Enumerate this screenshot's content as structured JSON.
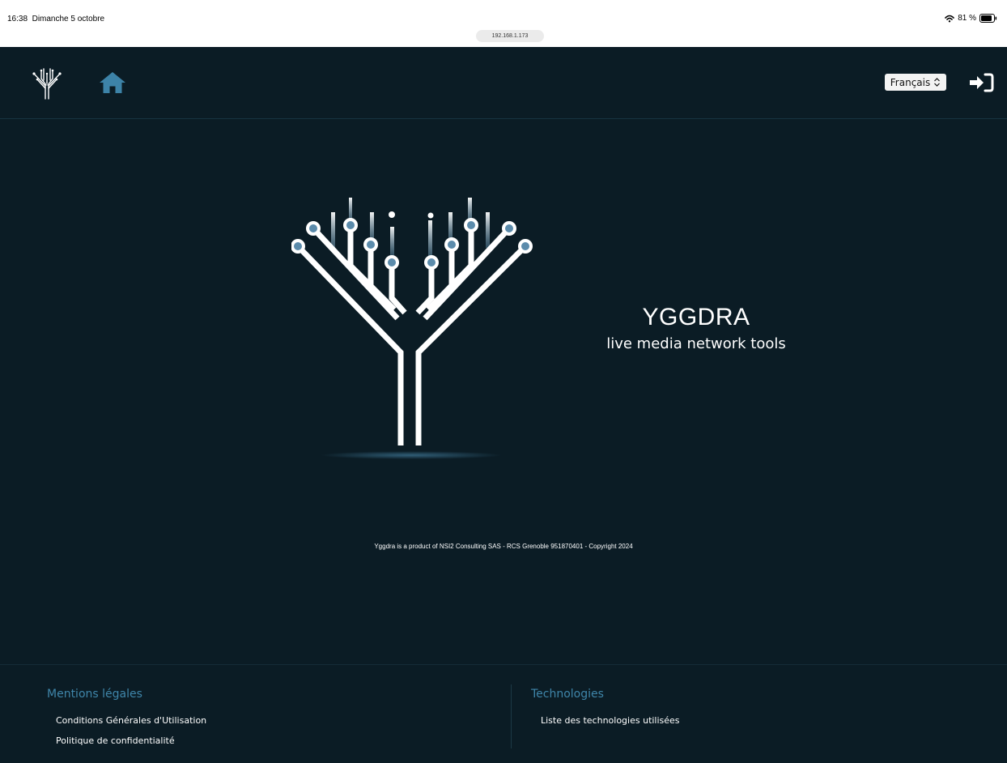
{
  "status_bar": {
    "time": "16:38",
    "date": "Dimanche 5 octobre",
    "url": "192.168.1.173",
    "battery": "81 %",
    "icons": [
      "wifi-icon",
      "battery-icon"
    ]
  },
  "header": {
    "logo_icon": "yggdra-tree-logo-icon",
    "home_icon": "home-icon",
    "language": {
      "selected": "Français"
    },
    "login_icon": "login-arrow-icon"
  },
  "hero": {
    "title": "YGGDRA",
    "subtitle": "live media network tools"
  },
  "copyright": "Yggdra is a product of NSI2 Consulting SAS - RCS Grenoble 951870401 - Copyright 2024",
  "footer": {
    "legal": {
      "heading": "Mentions légales",
      "links": [
        "Conditions Générales d'Utilisation",
        "Politique de confidentialité"
      ]
    },
    "tech": {
      "heading": "Technologies",
      "links": [
        "Liste des technologies utilisées"
      ]
    }
  },
  "colors": {
    "background": "#0b1c25",
    "accent": "#3f86aa",
    "node": "#5b8bab",
    "status_bar": "#ffffff"
  }
}
